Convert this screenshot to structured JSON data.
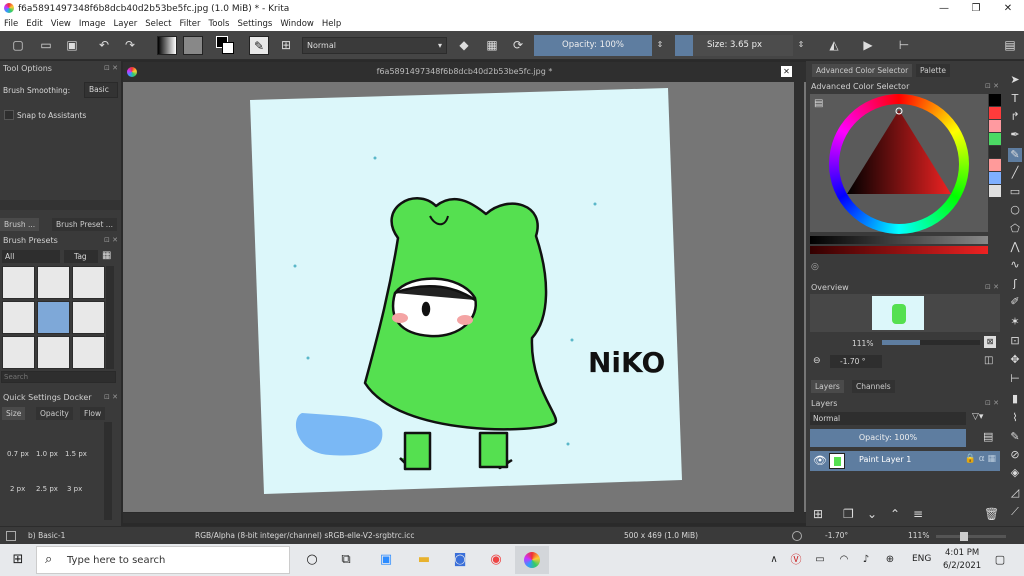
{
  "window": {
    "title": "f6a5891497348f6b8dcb40d2b53be5fc.jpg (1.0 MiB)  * - Krita",
    "min": "—",
    "max": "❐",
    "close": "✕"
  },
  "menu": [
    "File",
    "Edit",
    "View",
    "Image",
    "Layer",
    "Select",
    "Filter",
    "Tools",
    "Settings",
    "Window",
    "Help"
  ],
  "toolbar": {
    "blend_mode": "Normal",
    "opacity": "Opacity: 100%",
    "size": "Size: 3.65 px"
  },
  "tool_options": {
    "title": "Tool Options",
    "smoothing_label": "Brush Smoothing:",
    "smoothing_value": "Basic",
    "snap_label": "Snap to Assistants"
  },
  "left_tabs": [
    "Brush ...",
    "Brush Preset ..."
  ],
  "brush_presets": {
    "title": "Brush Presets",
    "filter": "All",
    "tag": "Tag",
    "search_placeholder": "Search"
  },
  "quick_settings": {
    "title": "Quick Settings Docker",
    "tabs": [
      "Size",
      "Opacity",
      "Flow"
    ],
    "sizes": [
      "0.7 px",
      "1.0 px",
      "1.5 px",
      "2 px",
      "2.5 px",
      "3 px"
    ]
  },
  "document": {
    "tab_title": "f6a5891497348f6b8dcb40d2b53be5fc.jpg *",
    "drawing_text": "NiKO"
  },
  "color_panel": {
    "tabs": [
      "Advanced Color Selector",
      "Palette"
    ],
    "title": "Advanced Color Selector",
    "swatches": [
      "#000000",
      "#ff3b3b",
      "#ff9aa0",
      "#4cd964",
      "#2a2a2a",
      "#ff9a9a",
      "#7fb0ff",
      "#e0e0e0"
    ]
  },
  "overview": {
    "title": "Overview",
    "zoom": "111%",
    "rotation": "-1.70 °"
  },
  "layers": {
    "tabs": [
      "Layers",
      "Channels"
    ],
    "title": "Layers",
    "blend": "Normal",
    "opacity": "Opacity:  100%",
    "layer_name": "Paint Layer 1"
  },
  "status": {
    "brush": "b) Basic-1",
    "color_info": "RGB/Alpha (8-bit integer/channel)  sRGB-elle-V2-srgbtrc.icc",
    "dimensions": "500 x 469 (1.0 MiB)",
    "rotation": "-1.70°",
    "zoom": "111%"
  },
  "taskbar": {
    "search_placeholder": "Type here to search",
    "lang": "ENG",
    "time": "4:01 PM",
    "date": "6/2/2021"
  }
}
